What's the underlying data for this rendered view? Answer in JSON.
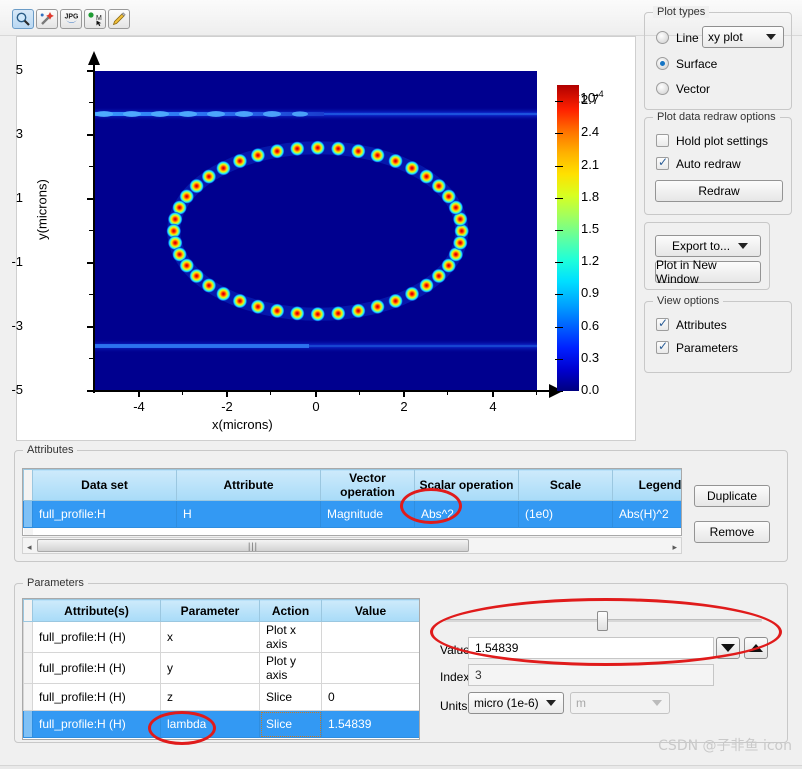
{
  "toolbar": {
    "buttons": [
      {
        "name": "zoom-icon",
        "label": "Zoom"
      },
      {
        "name": "magic-wand-icon",
        "label": "Auto scale"
      },
      {
        "name": "jpg-export-icon",
        "label": "JPG"
      },
      {
        "name": "marker-icon",
        "label": "Marker"
      },
      {
        "name": "pencil-edit-icon",
        "label": "Edit"
      }
    ]
  },
  "chart_data": {
    "type": "heatmap",
    "title": "",
    "xlabel": "x(microns)",
    "ylabel": "y(microns)",
    "xlim": [
      -5,
      5
    ],
    "ylim": [
      -5,
      5
    ],
    "xticks": [
      -4,
      -2,
      0,
      2,
      4
    ],
    "yticks": [
      5,
      3,
      1,
      -1,
      -3,
      -5
    ],
    "xtick_labels": [
      "-4",
      "-2",
      "0",
      "2",
      "4"
    ],
    "ytick_labels": [
      "5",
      "3",
      "1",
      "-1",
      "-3",
      "-5"
    ],
    "grid": false,
    "colorbar": {
      "multiplier": "x10",
      "exponent": "-4",
      "ticks": [
        2.7,
        2.4,
        2.1,
        1.8,
        1.5,
        1.2,
        0.9,
        0.6,
        0.3,
        0.0
      ],
      "tick_labels": [
        "2.7",
        "2.4",
        "2.1",
        "1.8",
        "1.5",
        "1.2",
        "0.9",
        "0.6",
        "0.3",
        "0.0"
      ],
      "vmin": 0.0,
      "vmax": 2.85,
      "colormap": "jet"
    },
    "features": {
      "description": "Ring resonator whispering-gallery mode intensity |H|^2",
      "ring_center": [
        0.05,
        0.0
      ],
      "ring_radius_x": 3.25,
      "ring_radius_y": 2.6,
      "mode_lobes": 44,
      "bus_waveguides_y": [
        3.4,
        -3.45
      ]
    }
  },
  "plot_types": {
    "legend": "Plot types",
    "options": [
      {
        "label": "Line",
        "selected": false
      },
      {
        "label": "Surface",
        "selected": true
      },
      {
        "label": "Vector",
        "selected": false
      }
    ],
    "line_combo_value": "xy plot"
  },
  "redraw_options": {
    "legend": "Plot data redraw options",
    "hold_plot_settings": {
      "label": "Hold plot settings",
      "checked": false
    },
    "auto_redraw": {
      "label": "Auto redraw",
      "checked": true
    },
    "redraw_button": "Redraw"
  },
  "export_group": {
    "export_button": "Export to...",
    "new_window_button": "Plot in New Window"
  },
  "view_options": {
    "legend": "View options",
    "attributes": {
      "label": "Attributes",
      "checked": true
    },
    "parameters": {
      "label": "Parameters",
      "checked": true
    }
  },
  "attributes_panel": {
    "legend": "Attributes",
    "columns": [
      "Data set",
      "Attribute",
      "Vector operation",
      "Scalar operation",
      "Scale",
      "Legend"
    ],
    "rows": [
      {
        "selected": true,
        "cells": [
          "full_profile:H",
          "H",
          "Magnitude",
          "Abs^2",
          "(1e0)",
          "Abs(H)^2"
        ]
      }
    ],
    "buttons": {
      "duplicate": "Duplicate",
      "remove": "Remove"
    },
    "scrollbar": {
      "left_arrow": "◂",
      "right_arrow": "▸",
      "grip": "|||"
    }
  },
  "parameters_panel": {
    "legend": "Parameters",
    "columns": [
      "Attribute(s)",
      "Parameter",
      "Action",
      "Value"
    ],
    "rows": [
      {
        "selected": false,
        "cells": [
          "full_profile:H (H)",
          "x",
          "Plot x axis",
          ""
        ]
      },
      {
        "selected": false,
        "cells": [
          "full_profile:H (H)",
          "y",
          "Plot y axis",
          ""
        ]
      },
      {
        "selected": false,
        "cells": [
          "full_profile:H (H)",
          "z",
          "Slice",
          "0"
        ]
      },
      {
        "selected": true,
        "cells": [
          "full_profile:H (H)",
          "lambda",
          "Slice",
          "1.54839"
        ]
      }
    ],
    "editor": {
      "slider_position_percent": 48,
      "value_label": "Value",
      "value": "1.54839",
      "index_label": "Index",
      "index": "3",
      "units_label": "Units",
      "units_prefix": "micro (1e-6)",
      "units_base": "m",
      "down_icon": "triangle-down-icon",
      "up_icon": "triangle-up-icon"
    }
  },
  "annotations": {
    "highlight_scalar_operation": "Abs^2",
    "highlight_parameter": "lambda",
    "highlight_value_editor": "Value slider"
  },
  "watermark": "CSDN @子非鱼 icon",
  "colors": {
    "accent": "#3399f3",
    "header": "#a8dbf8",
    "annotation": "#e01b1b",
    "plot_background": "#00008f"
  }
}
